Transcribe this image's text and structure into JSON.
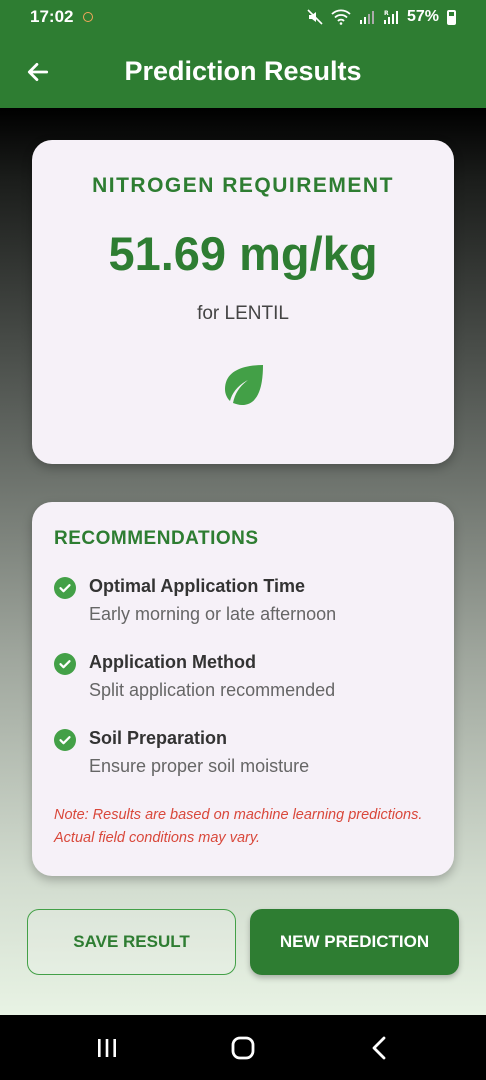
{
  "status_bar": {
    "time": "17:02",
    "battery": "57%",
    "icons": [
      "notification-dot-icon",
      "mute-icon",
      "wifi-icon",
      "signal-icon",
      "signal-roaming-icon",
      "battery-icon"
    ]
  },
  "app_bar": {
    "title": "Prediction Results",
    "back_icon": "arrow-left-icon"
  },
  "result_card": {
    "heading": "NITROGEN REQUIREMENT",
    "value": "51.69 mg/kg",
    "crop": "for LENTIL",
    "icon": "leaf-icon"
  },
  "recommendations": {
    "heading": "RECOMMENDATIONS",
    "items": [
      {
        "title": "Optimal Application Time",
        "description": "Early morning or late afternoon"
      },
      {
        "title": "Application Method",
        "description": "Split application recommended"
      },
      {
        "title": "Soil Preparation",
        "description": "Ensure proper soil moisture"
      }
    ],
    "note": "Note: Results are based on machine learning predictions. Actual field conditions may vary."
  },
  "buttons": {
    "save": "SAVE RESULT",
    "new": "NEW PREDICTION"
  },
  "colors": {
    "primary": "#2e7d32",
    "accent": "#43a047",
    "note": "#d9483b",
    "card": "#f6f1f8"
  }
}
